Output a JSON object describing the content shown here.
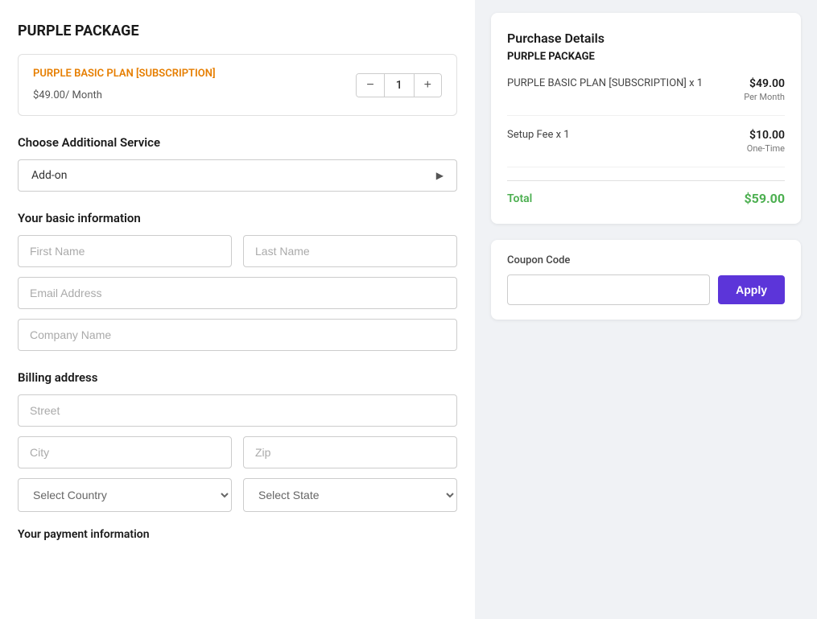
{
  "page": {
    "title": "PURPLE PACKAGE"
  },
  "package": {
    "plan_name": "PURPLE BASIC PLAN [SUBSCRIPTION]",
    "price": "$49.00",
    "period": "/ Month",
    "quantity": "1"
  },
  "additional_service": {
    "section_title": "Choose Additional Service",
    "placeholder": "Add-on"
  },
  "basic_info": {
    "section_title": "Your basic information",
    "first_name_placeholder": "First Name",
    "last_name_placeholder": "Last Name",
    "email_placeholder": "Email Address",
    "company_placeholder": "Company Name"
  },
  "billing": {
    "section_title": "Billing address",
    "street_placeholder": "Street",
    "city_placeholder": "City",
    "zip_placeholder": "Zip",
    "country_placeholder": "Select Country",
    "state_placeholder": "Select State"
  },
  "more_info": {
    "label": "Your payment information"
  },
  "purchase_details": {
    "card_title": "Purchase Details",
    "pkg_label": "PURPLE PACKAGE",
    "line1_label": "PURPLE BASIC PLAN [SUBSCRIPTION] x 1",
    "line1_price": "$49.00",
    "line1_sub": "Per Month",
    "line2_label": "Setup Fee x 1",
    "line2_price": "$10.00",
    "line2_sub": "One-Time",
    "total_label": "Total",
    "total_value": "$59.00"
  },
  "coupon": {
    "label": "Coupon Code",
    "input_placeholder": "",
    "apply_label": "Apply"
  },
  "icons": {
    "minus": "−",
    "plus": "+",
    "arrow_right": "▶"
  }
}
